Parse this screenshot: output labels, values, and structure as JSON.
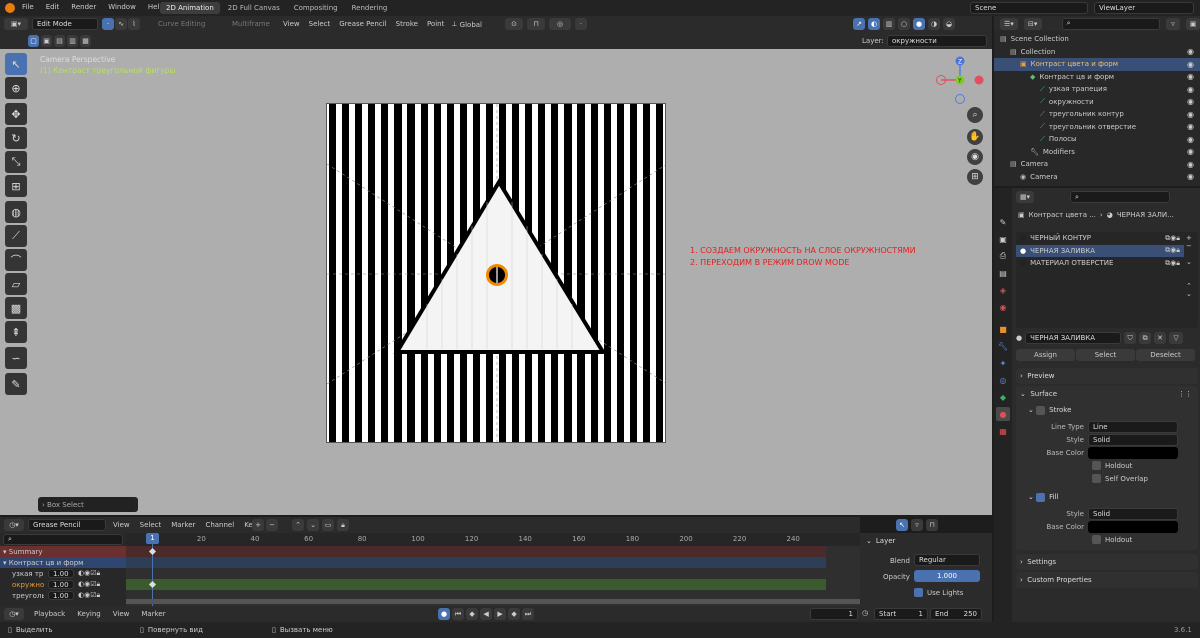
{
  "topbar": {
    "menu": [
      "File",
      "Edit",
      "Render",
      "Window",
      "Help"
    ],
    "workspaces": [
      "2D Animation",
      "2D Full Canvas",
      "Compositing",
      "Rendering"
    ],
    "active_workspace": "2D Animation",
    "scene_label": "Scene",
    "viewlayer_label": "ViewLayer"
  },
  "vp_header": {
    "mode": "Edit Mode",
    "curve_editing": "Curve Editing",
    "multiframe": "Multiframe",
    "menus": [
      "View",
      "Select",
      "Grease Pencil",
      "Stroke",
      "Point"
    ],
    "orientation": "Global"
  },
  "vp_sub": {
    "layer_label": "Layer:",
    "layer_value": "окружности"
  },
  "viewport": {
    "camera_title": "Camera Perspective",
    "camera_object": "(1) Контраст треугольной фигуры",
    "annotation_1": "1. СОЗДАЕМ ОКРУЖНОСТЬ НА СЛОЕ ОКРУЖНОСТЯМИ",
    "annotation_2": "2. ПЕРЕХОДИМ В РЕЖИМ DROW MODE",
    "box_select": "Box Select",
    "stripe_count": 26
  },
  "timeline": {
    "editor": "Grease Pencil",
    "menus": [
      "View",
      "Select",
      "Marker",
      "Channel",
      "Key"
    ],
    "ticks": [
      "1",
      "20",
      "40",
      "60",
      "80",
      "100",
      "120",
      "140",
      "160",
      "180",
      "200",
      "220",
      "240"
    ],
    "channels": [
      {
        "name": "Summary",
        "value": ""
      },
      {
        "name": "Контраст цв и форм",
        "value": ""
      },
      {
        "name": "узкая тр",
        "value": "1.00"
      },
      {
        "name": "окружно",
        "value": "1.00"
      },
      {
        "name": "треугольн",
        "value": "1.00"
      }
    ],
    "layer_panel_title": "Layer",
    "blend_label": "Blend",
    "blend_value": "Regular",
    "opacity_label": "Opacity",
    "opacity_value": "1.000",
    "use_lights": "Use Lights"
  },
  "playback": {
    "playback": "Playback",
    "keying": "Keying",
    "view": "View",
    "marker": "Marker",
    "current_frame": "1",
    "start_label": "Start",
    "start_value": "1",
    "end_label": "End",
    "end_value": "250"
  },
  "statusbar": {
    "select": "Выделить",
    "rotate": "Повернуть вид",
    "menu": "Вызвать меню",
    "version": "3.6.1"
  },
  "outliner": {
    "rows": [
      {
        "label": "Scene Collection",
        "indent": 0
      },
      {
        "label": "Collection",
        "indent": 1
      },
      {
        "label": "Контраст цвета и форм",
        "indent": 2
      },
      {
        "label": "Контраст цв и форм",
        "indent": 3
      },
      {
        "label": "узкая трапеция",
        "indent": 4
      },
      {
        "label": "окружности",
        "indent": 4
      },
      {
        "label": "треугольник контур",
        "indent": 4
      },
      {
        "label": "треугольник отверстие",
        "indent": 4
      },
      {
        "label": "Полосы",
        "indent": 4
      },
      {
        "label": "Modifiers",
        "indent": 3
      },
      {
        "label": "Camera",
        "indent": 1
      },
      {
        "label": "Camera",
        "indent": 2
      }
    ]
  },
  "properties": {
    "breadcrumb_1": "Контраст цвета ...",
    "breadcrumb_2": "ЧЕРНАЯ ЗАЛИ...",
    "materials": [
      "ЧЕРНЫЙ КОНТУР",
      "ЧЕРНАЯ ЗАЛИВКА",
      "МАТЕРИАЛ  ОТВЕРСТИЕ"
    ],
    "active_material": "ЧЕРНАЯ ЗАЛИВКА",
    "assign": "Assign",
    "select": "Select",
    "deselect": "Deselect",
    "preview": "Preview",
    "surface": "Surface",
    "stroke": "Stroke",
    "line_type_label": "Line Type",
    "line_type_value": "Line",
    "style_label": "Style",
    "style_value": "Solid",
    "base_color_label": "Base Color",
    "holdout": "Holdout",
    "self_overlap": "Self Overlap",
    "fill": "Fill",
    "fill_style_value": "Solid",
    "settings": "Settings",
    "custom_properties": "Custom Properties"
  },
  "colors": {
    "accent": "#4a72b0",
    "annotation": "#e32020",
    "selected_row": "#3a4f75",
    "keyframe_track": "#3b5a2e"
  }
}
